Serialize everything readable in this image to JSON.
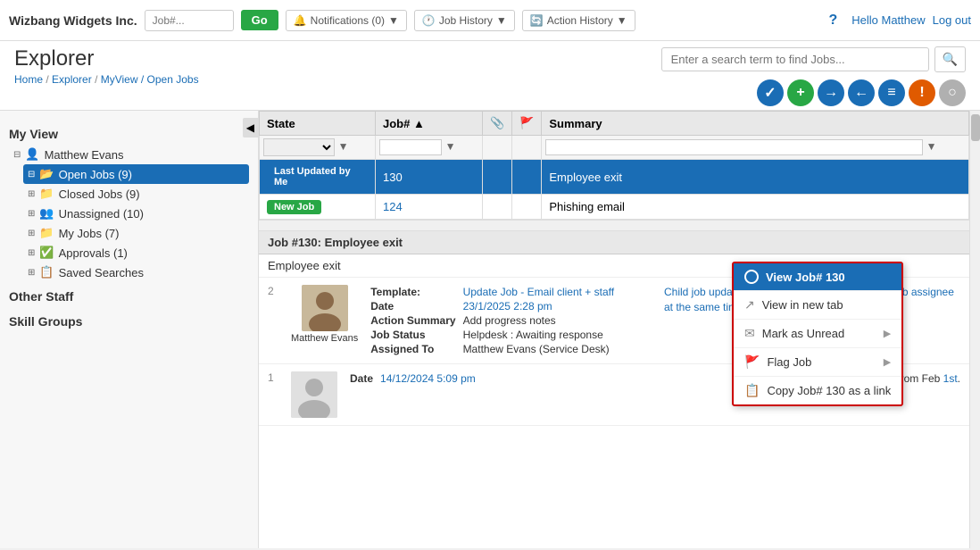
{
  "header": {
    "brand": "Wizbang Widgets Inc.",
    "job_input_placeholder": "Job#...",
    "go_label": "Go",
    "notifications_label": "Notifications (0)",
    "job_history_label": "Job History",
    "action_history_label": "Action History",
    "help_icon": "?",
    "hello_label": "Hello Matthew",
    "logout_label": "Log out"
  },
  "subheader": {
    "page_title": "Explorer",
    "breadcrumb": [
      {
        "label": "Home",
        "link": true
      },
      {
        "label": "Explorer",
        "link": true
      },
      {
        "label": "MyView / Open Jobs",
        "link": false,
        "current": true
      }
    ],
    "search_placeholder": "Enter a search term to find Jobs..."
  },
  "sidebar": {
    "my_view_title": "My View",
    "items": [
      {
        "label": "Matthew Evans",
        "type": "user",
        "expand": true,
        "selected": false
      },
      {
        "label": "Open Jobs (9)",
        "type": "open",
        "selected": true,
        "indent": true
      },
      {
        "label": "Closed Jobs (9)",
        "type": "closed",
        "selected": false,
        "indent": true
      },
      {
        "label": "Unassigned (10)",
        "type": "unassigned",
        "selected": false,
        "indent": true
      },
      {
        "label": "My Jobs (7)",
        "type": "myjobs",
        "selected": false,
        "indent": true
      },
      {
        "label": "Approvals (1)",
        "type": "approvals",
        "selected": false,
        "indent": true
      },
      {
        "label": "Saved Searches",
        "type": "saved",
        "selected": false,
        "indent": true
      }
    ],
    "other_staff_label": "Other Staff",
    "skill_groups_label": "Skill Groups"
  },
  "jobs_table": {
    "columns": [
      "State",
      "Job#",
      "",
      "",
      "Summary"
    ],
    "rows": [
      {
        "state_badge": "Last Updated by Me",
        "state_badge_color": "blue",
        "job_num": "130",
        "summary": "Employee exit",
        "selected": true
      },
      {
        "state_badge": "New Job",
        "state_badge_color": "green",
        "job_num": "124",
        "summary": "Phishing email",
        "selected": false
      }
    ]
  },
  "context_menu": {
    "header": "View Job# 130",
    "items": [
      {
        "label": "View in new tab",
        "icon": "external"
      },
      {
        "label": "Mark as Unread",
        "icon": "envelope"
      },
      {
        "label": "Flag Job",
        "icon": "flag",
        "has_arrow": true
      },
      {
        "label": "Copy Job# 130 as a link",
        "icon": "copy"
      }
    ]
  },
  "detail": {
    "job_header": "Job #130: Employee exit",
    "job_title": "Employee exit",
    "actions": [
      {
        "number": "2",
        "avatar_initials": "ME",
        "avatar_name": "Matthew Evans",
        "template_label": "Template:",
        "template_val": "Update Job - Email client + staff",
        "date_label": "Date",
        "date_val": "23/1/2025 2:28 pm",
        "action_summary_label": "Action Summary",
        "action_summary_val": "Add progress notes",
        "job_status_label": "Job Status",
        "job_status_val": "Helpdesk : Awaiting response",
        "assigned_label": "Assigned To",
        "assigned_val": "Matthew Evans (Service Desk)",
        "note": "Child job updated and notification sent to parent job assignee at the same time."
      },
      {
        "number": "1",
        "avatar_initials": "",
        "avatar_name": "",
        "date_label": "Date",
        "date_val": "14/12/2024 5:09 pm",
        "note": "Blake is leaving WBW from Feb 1st."
      }
    ]
  }
}
